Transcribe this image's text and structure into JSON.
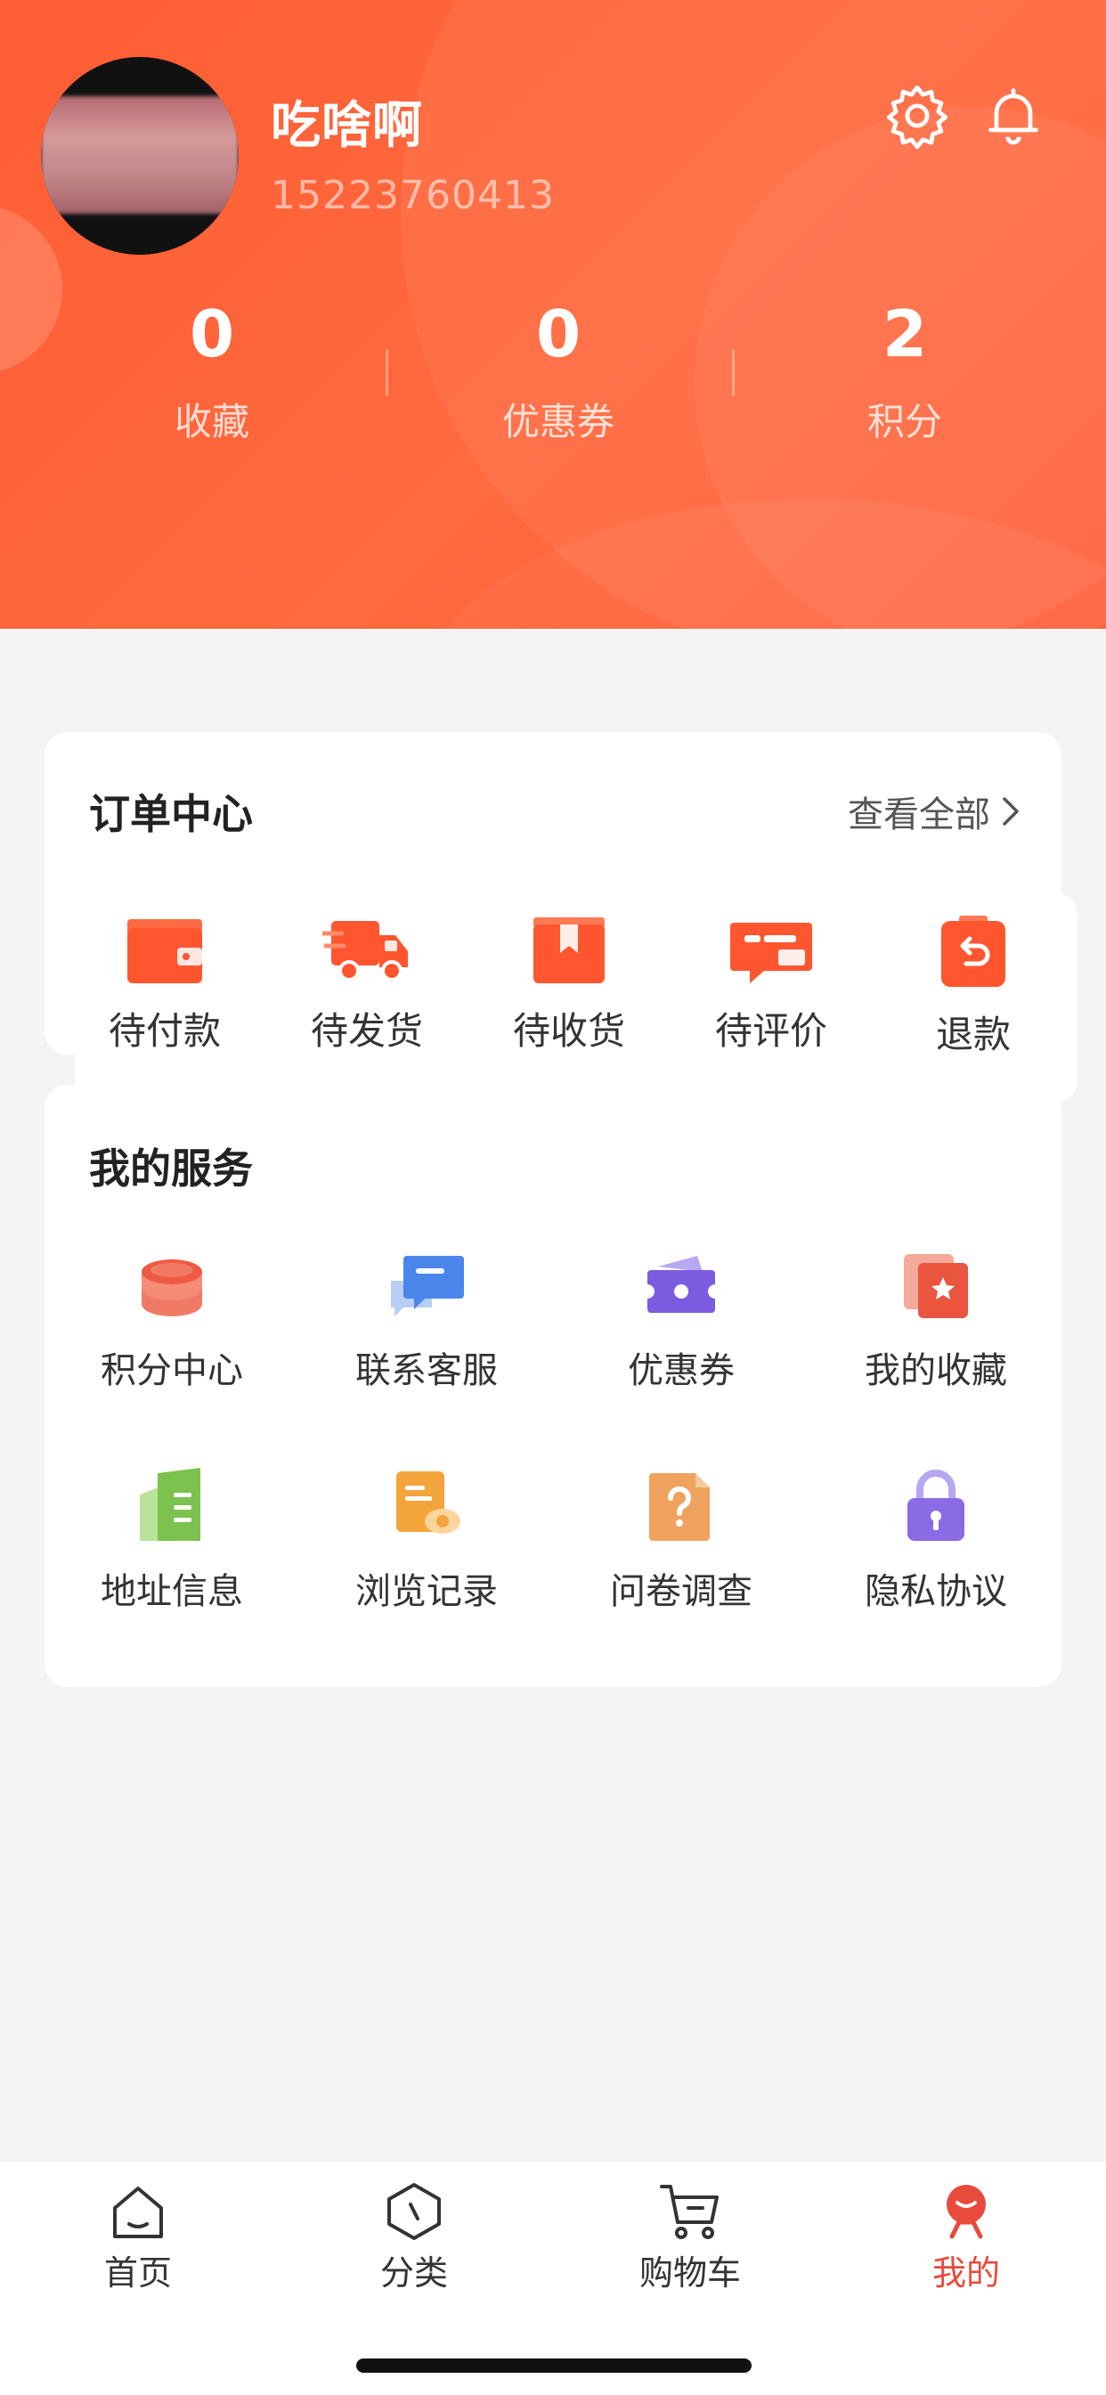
{
  "profile": {
    "username": "吃啥啊",
    "phone": "15223760413"
  },
  "header_icons": [
    "gear-icon",
    "bell-icon"
  ],
  "stats": [
    {
      "value": "0",
      "label": "收藏"
    },
    {
      "value": "0",
      "label": "优惠券"
    },
    {
      "value": "2",
      "label": "积分"
    }
  ],
  "orders": {
    "title": "订单中心",
    "view_all": "查看全部",
    "items": [
      {
        "label": "待付款",
        "icon": "wallet-icon"
      },
      {
        "label": "待发货",
        "icon": "truck-icon"
      },
      {
        "label": "待收货",
        "icon": "package-icon"
      },
      {
        "label": "待评价",
        "icon": "review-icon"
      },
      {
        "label": "退款",
        "icon": "refund-icon"
      }
    ]
  },
  "services": {
    "title": "我的服务",
    "items": [
      {
        "label": "积分中心",
        "icon": "coins-icon"
      },
      {
        "label": "联系客服",
        "icon": "chat-icon"
      },
      {
        "label": "优惠券",
        "icon": "coupon-icon"
      },
      {
        "label": "我的收藏",
        "icon": "favorite-icon"
      },
      {
        "label": "地址信息",
        "icon": "address-icon"
      },
      {
        "label": "浏览记录",
        "icon": "history-icon"
      },
      {
        "label": "问卷调查",
        "icon": "survey-icon"
      },
      {
        "label": "隐私协议",
        "icon": "lock-icon"
      }
    ]
  },
  "tabs": [
    {
      "label": "首页",
      "icon": "home-icon"
    },
    {
      "label": "分类",
      "icon": "category-icon"
    },
    {
      "label": "购物车",
      "icon": "cart-icon"
    },
    {
      "label": "我的",
      "icon": "profile-icon",
      "active": true
    }
  ],
  "colors": {
    "brand": "#ff5d33",
    "active_tab": "#e84a3b"
  }
}
